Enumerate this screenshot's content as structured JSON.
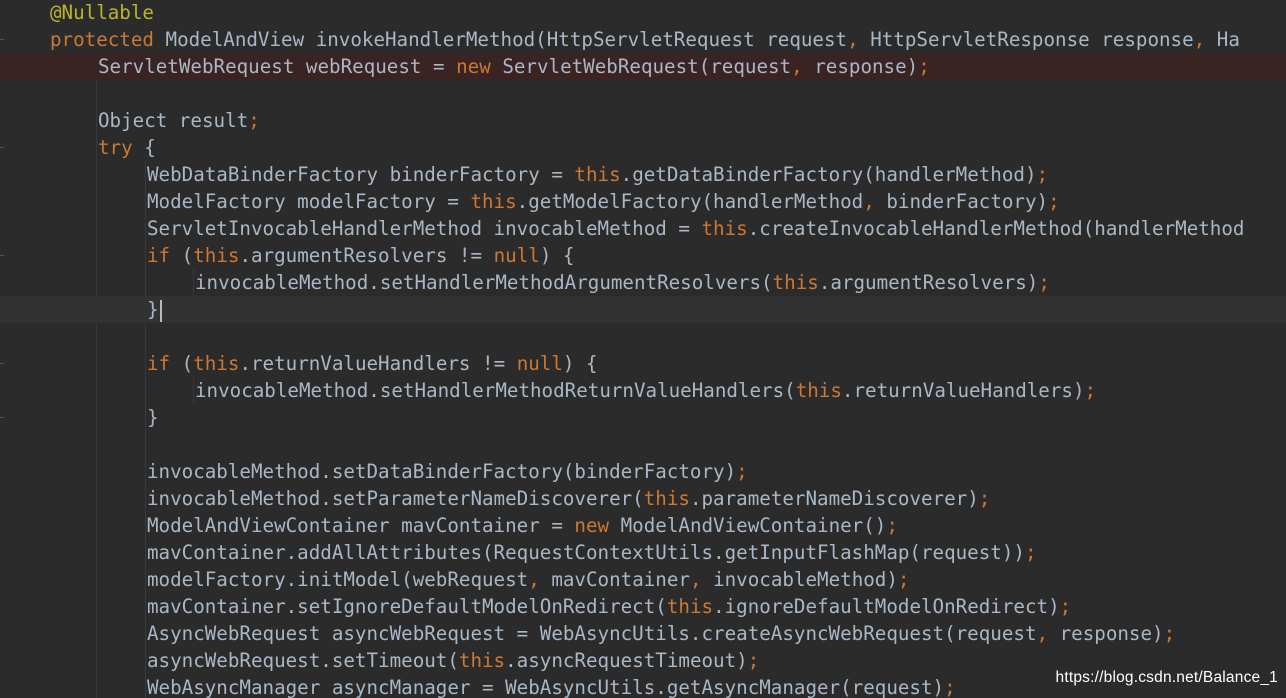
{
  "colors": {
    "background": "#2b2b2b",
    "plain": "#a9b7c6",
    "keyword": "#cc7832",
    "annotation": "#bbb529",
    "breakpoint_line": "#3a2323",
    "caret_line": "#323232"
  },
  "editor": {
    "lines": [
      {
        "segments": [
          {
            "t": "@Nullable",
            "c": "annotation"
          }
        ]
      },
      {
        "segments": [
          {
            "t": "protected",
            "c": "keyword"
          },
          {
            "t": " ModelAndView invokeHandlerMethod(HttpServletRequest request",
            "c": "plain"
          },
          {
            "t": ",",
            "c": "keyword"
          },
          {
            "t": " HttpServletResponse response",
            "c": "plain"
          },
          {
            "t": ",",
            "c": "keyword"
          },
          {
            "t": " Ha",
            "c": "plain"
          }
        ]
      },
      {
        "segments": [
          {
            "t": "ServletWebRequest webRequest = ",
            "c": "plain"
          },
          {
            "t": "new",
            "c": "keyword"
          },
          {
            "t": " ServletWebRequest(request",
            "c": "plain"
          },
          {
            "t": ",",
            "c": "keyword"
          },
          {
            "t": " response)",
            "c": "plain"
          },
          {
            "t": ";",
            "c": "keyword"
          }
        ]
      },
      {
        "segments": []
      },
      {
        "segments": [
          {
            "t": "Object result",
            "c": "plain"
          },
          {
            "t": ";",
            "c": "keyword"
          }
        ]
      },
      {
        "segments": [
          {
            "t": "try",
            "c": "keyword"
          },
          {
            "t": " {",
            "c": "plain"
          }
        ]
      },
      {
        "segments": [
          {
            "t": "WebDataBinderFactory binderFactory = ",
            "c": "plain"
          },
          {
            "t": "this",
            "c": "keyword"
          },
          {
            "t": ".getDataBinderFactory(handlerMethod)",
            "c": "plain"
          },
          {
            "t": ";",
            "c": "keyword"
          }
        ]
      },
      {
        "segments": [
          {
            "t": "ModelFactory modelFactory = ",
            "c": "plain"
          },
          {
            "t": "this",
            "c": "keyword"
          },
          {
            "t": ".getModelFactory(handlerMethod",
            "c": "plain"
          },
          {
            "t": ",",
            "c": "keyword"
          },
          {
            "t": " binderFactory)",
            "c": "plain"
          },
          {
            "t": ";",
            "c": "keyword"
          }
        ]
      },
      {
        "segments": [
          {
            "t": "ServletInvocableHandlerMethod invocableMethod = ",
            "c": "plain"
          },
          {
            "t": "this",
            "c": "keyword"
          },
          {
            "t": ".createInvocableHandlerMethod(handlerMethod",
            "c": "plain"
          }
        ]
      },
      {
        "segments": [
          {
            "t": "if",
            "c": "keyword"
          },
          {
            "t": " (",
            "c": "plain"
          },
          {
            "t": "this",
            "c": "keyword"
          },
          {
            "t": ".argumentResolvers != ",
            "c": "plain"
          },
          {
            "t": "null",
            "c": "keyword"
          },
          {
            "t": ") {",
            "c": "plain"
          }
        ]
      },
      {
        "segments": [
          {
            "t": "invocableMethod.setHandlerMethodArgumentResolvers(",
            "c": "plain"
          },
          {
            "t": "this",
            "c": "keyword"
          },
          {
            "t": ".argumentResolvers)",
            "c": "plain"
          },
          {
            "t": ";",
            "c": "keyword"
          }
        ]
      },
      {
        "segments": [
          {
            "t": "}",
            "c": "plain"
          }
        ]
      },
      {
        "segments": []
      },
      {
        "segments": [
          {
            "t": "if",
            "c": "keyword"
          },
          {
            "t": " (",
            "c": "plain"
          },
          {
            "t": "this",
            "c": "keyword"
          },
          {
            "t": ".returnValueHandlers != ",
            "c": "plain"
          },
          {
            "t": "null",
            "c": "keyword"
          },
          {
            "t": ") {",
            "c": "plain"
          }
        ]
      },
      {
        "segments": [
          {
            "t": "invocableMethod.setHandlerMethodReturnValueHandlers(",
            "c": "plain"
          },
          {
            "t": "this",
            "c": "keyword"
          },
          {
            "t": ".returnValueHandlers)",
            "c": "plain"
          },
          {
            "t": ";",
            "c": "keyword"
          }
        ]
      },
      {
        "segments": [
          {
            "t": "}",
            "c": "plain"
          }
        ]
      },
      {
        "segments": []
      },
      {
        "segments": [
          {
            "t": "invocableMethod.setDataBinderFactory(binderFactory)",
            "c": "plain"
          },
          {
            "t": ";",
            "c": "keyword"
          }
        ]
      },
      {
        "segments": [
          {
            "t": "invocableMethod.setParameterNameDiscoverer(",
            "c": "plain"
          },
          {
            "t": "this",
            "c": "keyword"
          },
          {
            "t": ".parameterNameDiscoverer)",
            "c": "plain"
          },
          {
            "t": ";",
            "c": "keyword"
          }
        ]
      },
      {
        "segments": [
          {
            "t": "ModelAndViewContainer mavContainer = ",
            "c": "plain"
          },
          {
            "t": "new",
            "c": "keyword"
          },
          {
            "t": " ModelAndViewContainer()",
            "c": "plain"
          },
          {
            "t": ";",
            "c": "keyword"
          }
        ]
      },
      {
        "segments": [
          {
            "t": "mavContainer.addAllAttributes(RequestContextUtils.getInputFlashMap(request))",
            "c": "plain"
          },
          {
            "t": ";",
            "c": "keyword"
          }
        ]
      },
      {
        "segments": [
          {
            "t": "modelFactory.initModel(webRequest",
            "c": "plain"
          },
          {
            "t": ",",
            "c": "keyword"
          },
          {
            "t": " mavContainer",
            "c": "plain"
          },
          {
            "t": ",",
            "c": "keyword"
          },
          {
            "t": " invocableMethod)",
            "c": "plain"
          },
          {
            "t": ";",
            "c": "keyword"
          }
        ]
      },
      {
        "segments": [
          {
            "t": "mavContainer.setIgnoreDefaultModelOnRedirect(",
            "c": "plain"
          },
          {
            "t": "this",
            "c": "keyword"
          },
          {
            "t": ".ignoreDefaultModelOnRedirect)",
            "c": "plain"
          },
          {
            "t": ";",
            "c": "keyword"
          }
        ]
      },
      {
        "segments": [
          {
            "t": "AsyncWebRequest asyncWebRequest = WebAsyncUtils.createAsyncWebRequest(request",
            "c": "plain"
          },
          {
            "t": ",",
            "c": "keyword"
          },
          {
            "t": " response)",
            "c": "plain"
          },
          {
            "t": ";",
            "c": "keyword"
          }
        ]
      },
      {
        "segments": [
          {
            "t": "asyncWebRequest.setTimeout(",
            "c": "plain"
          },
          {
            "t": "this",
            "c": "keyword"
          },
          {
            "t": ".asyncRequestTimeout)",
            "c": "plain"
          },
          {
            "t": ";",
            "c": "keyword"
          }
        ]
      },
      {
        "segments": [
          {
            "t": "WebAsyncManager asyncManager = WebAsyncUtils.getAsyncManager(request)",
            "c": "plain"
          },
          {
            "t": ";",
            "c": "keyword"
          }
        ]
      }
    ]
  },
  "watermark": "https://blog.csdn.net/Balance_1"
}
